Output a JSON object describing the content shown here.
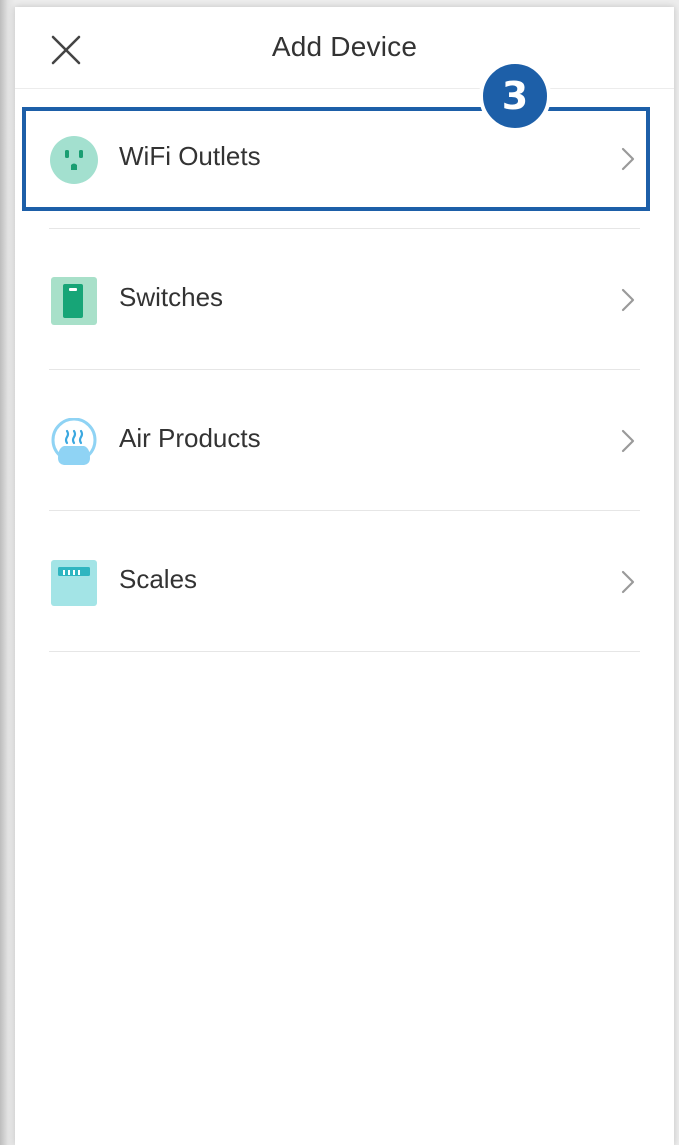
{
  "header": {
    "title": "Add Device",
    "close_icon": "close-icon"
  },
  "device_categories": [
    {
      "label": "WiFi Outlets",
      "icon": "outlet-icon",
      "icon_bg": "#a3e0cf"
    },
    {
      "label": "Switches",
      "icon": "switch-icon",
      "icon_bg": "#a8e0c9"
    },
    {
      "label": "Air Products",
      "icon": "air-purifier-icon",
      "icon_bg": "#8fd3f4"
    },
    {
      "label": "Scales",
      "icon": "scale-icon",
      "icon_bg": "#a3e4e6"
    }
  ],
  "annotation": {
    "step_number": "3",
    "highlighted_item": "WiFi Outlets",
    "color": "#1d5fa8"
  },
  "colors": {
    "text": "#333333",
    "accent": "#1d5fa8",
    "teal_icon": "#2fbf8a"
  }
}
